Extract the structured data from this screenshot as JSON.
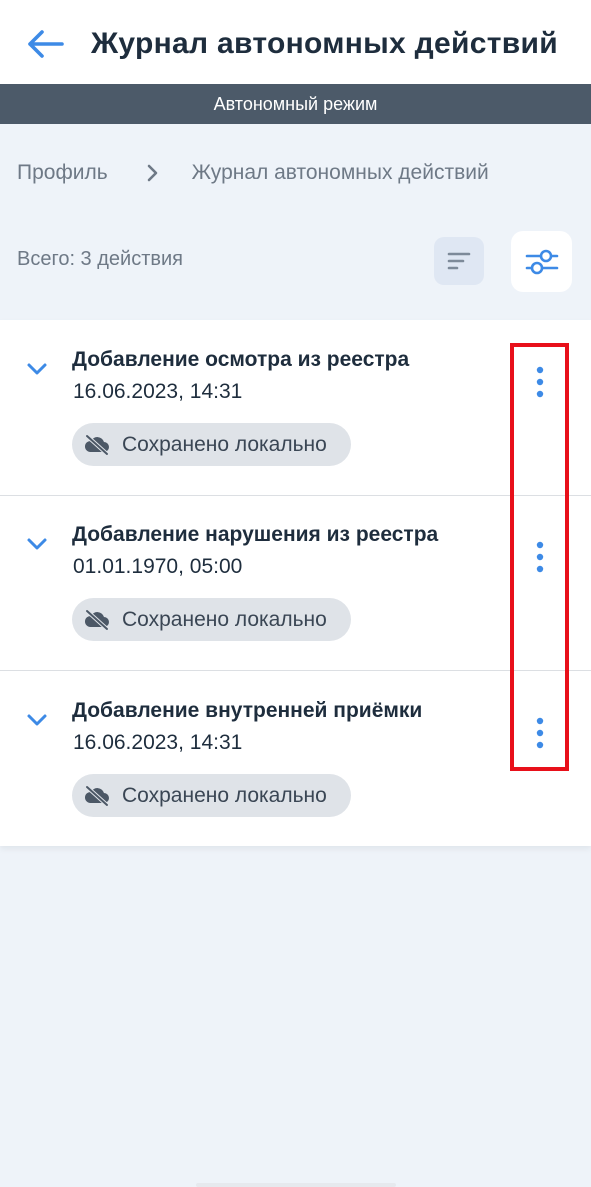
{
  "header": {
    "title": "Журнал автономных действий",
    "back_icon": "arrow-left-icon"
  },
  "banner": {
    "text": "Автономный режим"
  },
  "breadcrumb": {
    "items": [
      "Профиль",
      "Журнал автономных действий"
    ],
    "separator_icon": "chevron-right-icon"
  },
  "toolbar": {
    "total": "Всего: 3 действия",
    "sort_icon": "sort-icon",
    "filter_icon": "sliders-icon"
  },
  "items": [
    {
      "title": "Добавление осмотра из реестра",
      "date": "16.06.2023, 14:31",
      "status": "Сохранено локально",
      "status_icon": "cloud-off-icon",
      "more_icon": "more-vertical-icon"
    },
    {
      "title": "Добавление нарушения из реестра",
      "date": "01.01.1970, 05:00",
      "status": "Сохранено локально",
      "status_icon": "cloud-off-icon",
      "more_icon": "more-vertical-icon"
    },
    {
      "title": "Добавление внутренней приёмки",
      "date": "16.06.2023, 14:31",
      "status": "Сохранено локально",
      "status_icon": "cloud-off-icon",
      "more_icon": "more-vertical-icon"
    }
  ],
  "colors": {
    "accent": "#3d8ae6",
    "banner_bg": "#4c5a69",
    "page_bg": "#eef3f9",
    "highlight": "#e8101a"
  }
}
